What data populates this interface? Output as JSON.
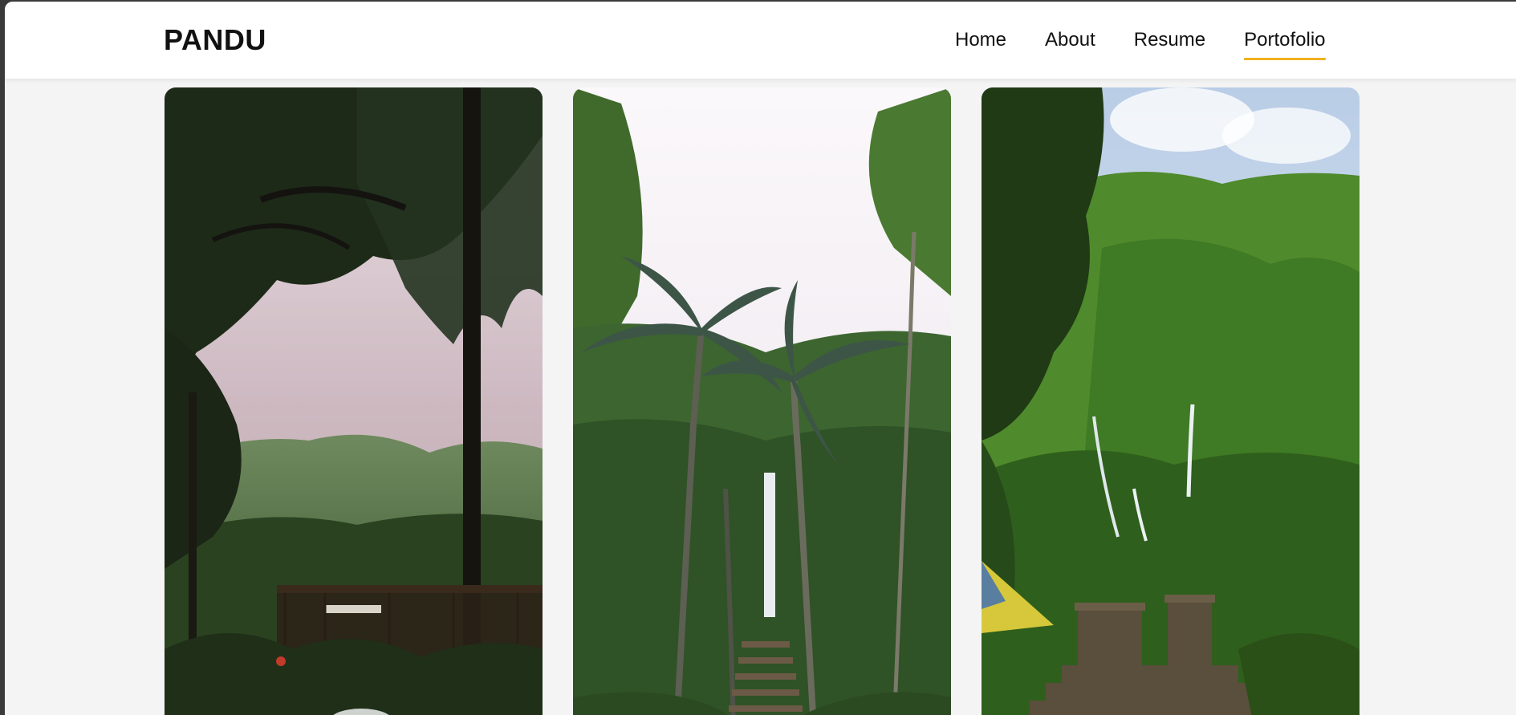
{
  "header": {
    "brand": "PANDU",
    "nav": [
      {
        "label": "Home",
        "active": false
      },
      {
        "label": "About",
        "active": false
      },
      {
        "label": "Resume",
        "active": false
      },
      {
        "label": "Portofolio",
        "active": true
      }
    ],
    "accent_color": "#f2b01e"
  },
  "portfolio": {
    "cards": [
      {
        "subject": "forest canopy overlooking misty hills with wooden terrace"
      },
      {
        "subject": "palm trees and stone stairway leading to waterfall"
      },
      {
        "subject": "lush green cliff with waterfalls and stone ruins"
      }
    ]
  }
}
